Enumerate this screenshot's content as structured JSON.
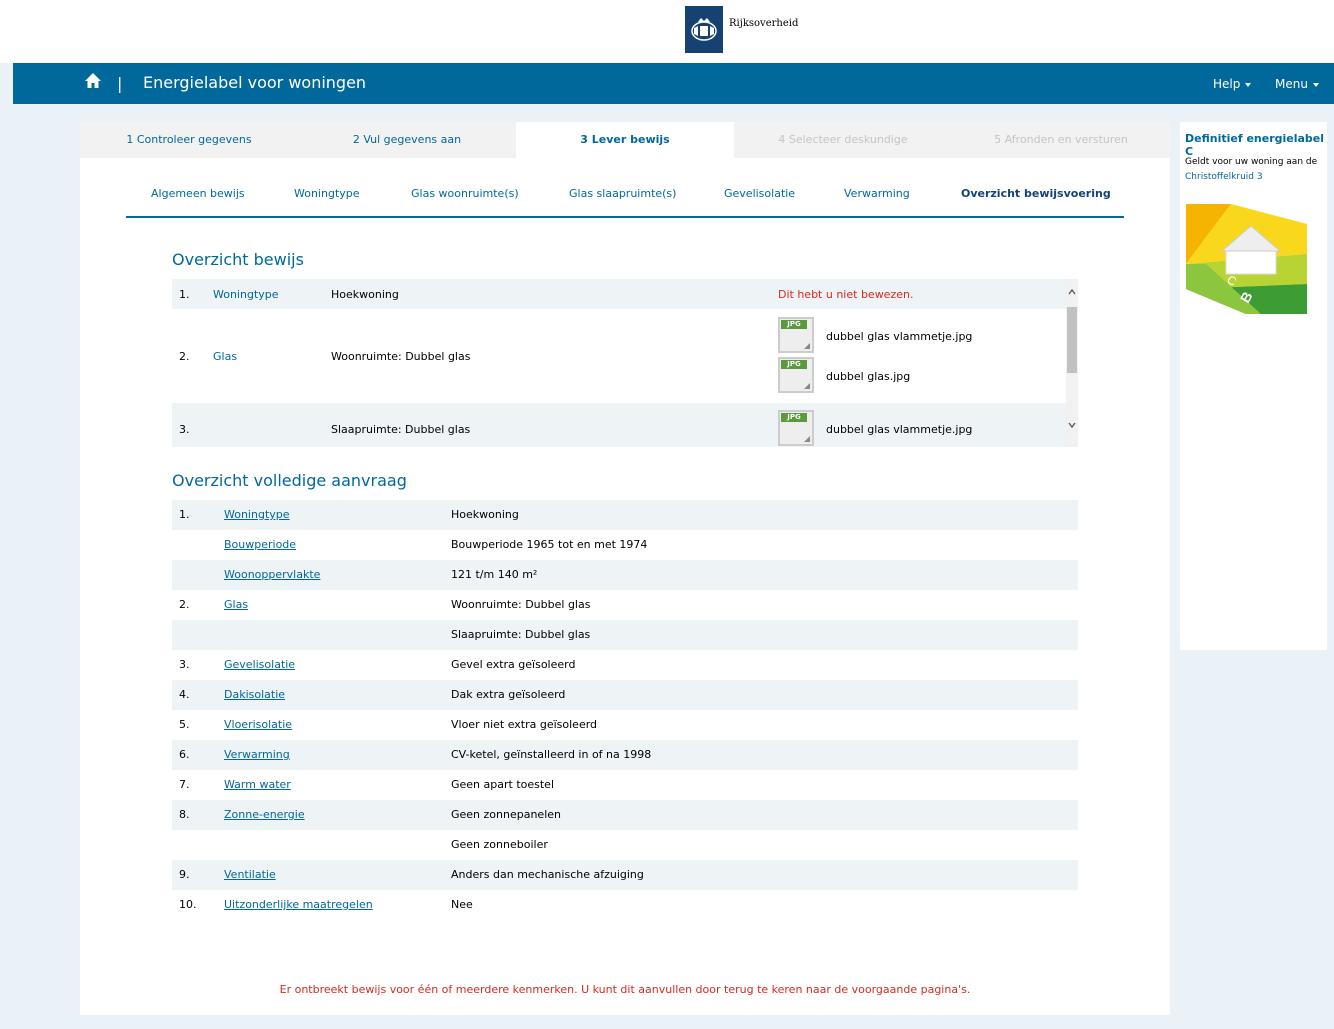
{
  "header": {
    "logo_text": "Rijksoverheid",
    "title": "Energielabel voor woningen",
    "separator": "|",
    "help_label": "Help",
    "menu_label": "Menu"
  },
  "steps": [
    {
      "label": "1 Controleer gegevens",
      "state": "done"
    },
    {
      "label": "2 Vul gegevens aan",
      "state": "done"
    },
    {
      "label": "3 Lever bewijs",
      "state": "active"
    },
    {
      "label": "4 Selecteer deskundige",
      "state": "disabled"
    },
    {
      "label": "5 Afronden en versturen",
      "state": "disabled"
    }
  ],
  "subtabs": [
    {
      "label": "Algemeen bewijs"
    },
    {
      "label": "Woningtype"
    },
    {
      "label": "Glas woonruimte(s)"
    },
    {
      "label": "Glas slaapruimte(s)"
    },
    {
      "label": "Gevelisolatie"
    },
    {
      "label": "Verwarming"
    },
    {
      "label": "Overzicht bewijsvoering",
      "active": true
    }
  ],
  "bewijs": {
    "title": "Overzicht bewijs",
    "rows": [
      {
        "num": "1.",
        "link": "Woningtype",
        "value": "Hoekwoning",
        "warning": "Dit hebt u niet bewezen."
      },
      {
        "num": "2.",
        "link": "Glas",
        "value": "Woonruimte: Dubbel glas",
        "files": [
          "dubbel glas vlammetje.jpg",
          "dubbel glas.jpg"
        ]
      },
      {
        "num": "3.",
        "link": "",
        "value": "Slaapruimte: Dubbel glas",
        "files": [
          "dubbel glas vlammetje.jpg"
        ]
      }
    ],
    "file_icon_tag": "JPG"
  },
  "overview": {
    "title": "Overzicht volledige aanvraag",
    "rows": [
      {
        "num": "1.",
        "link": "Woningtype",
        "value": "Hoekwoning"
      },
      {
        "num": "",
        "link": "Bouwperiode",
        "value": "Bouwperiode 1965 tot en met 1974"
      },
      {
        "num": "",
        "link": "Woonoppervlakte",
        "value": "121 t/m 140 m²"
      },
      {
        "num": "2.",
        "link": "Glas",
        "value": "Woonruimte: Dubbel glas"
      },
      {
        "num": "",
        "link": "",
        "value": "Slaapruimte: Dubbel glas"
      },
      {
        "num": "3.",
        "link": "Gevelisolatie",
        "value": "Gevel extra geïsoleerd"
      },
      {
        "num": "4.",
        "link": "Dakisolatie",
        "value": "Dak extra geïsoleerd"
      },
      {
        "num": "5.",
        "link": "Vloerisolatie",
        "value": "Vloer niet extra geïsoleerd"
      },
      {
        "num": "6.",
        "link": "Verwarming",
        "value": "CV-ketel, geïnstalleerd in of na 1998"
      },
      {
        "num": "7.",
        "link": "Warm water",
        "value": "Geen apart toestel"
      },
      {
        "num": "8.",
        "link": "Zonne-energie",
        "value": "Geen zonnepanelen"
      },
      {
        "num": "",
        "link": "",
        "value": "Geen zonneboiler"
      },
      {
        "num": "9.",
        "link": "Ventilatie",
        "value": "Anders dan mechanische afzuiging"
      },
      {
        "num": "10.",
        "link": "Uitzonderlijke maatregelen",
        "value": "Nee"
      }
    ]
  },
  "error_message": "Er ontbreekt bewijs voor één of meerdere kenmerken. U kunt dit aanvullen door terug te keren naar de voorgaande pagina's.",
  "sidebar": {
    "title": "Definitief energielabel C",
    "description": "Geldt voor uw woning aan de",
    "address": "Christoffelkruid 3",
    "label_letters": [
      "C",
      "B"
    ]
  },
  "colors": {
    "brand_blue": "#01689b",
    "dark_blue": "#154273",
    "error_red": "#d52b1e",
    "row_shade": "#eef3f6"
  },
  "icons": [
    "cursor-icon",
    "rijksoverheid-logo-icon",
    "home-icon",
    "chevron-up-icon",
    "chevron-down-icon",
    "jpg-file-icon"
  ]
}
